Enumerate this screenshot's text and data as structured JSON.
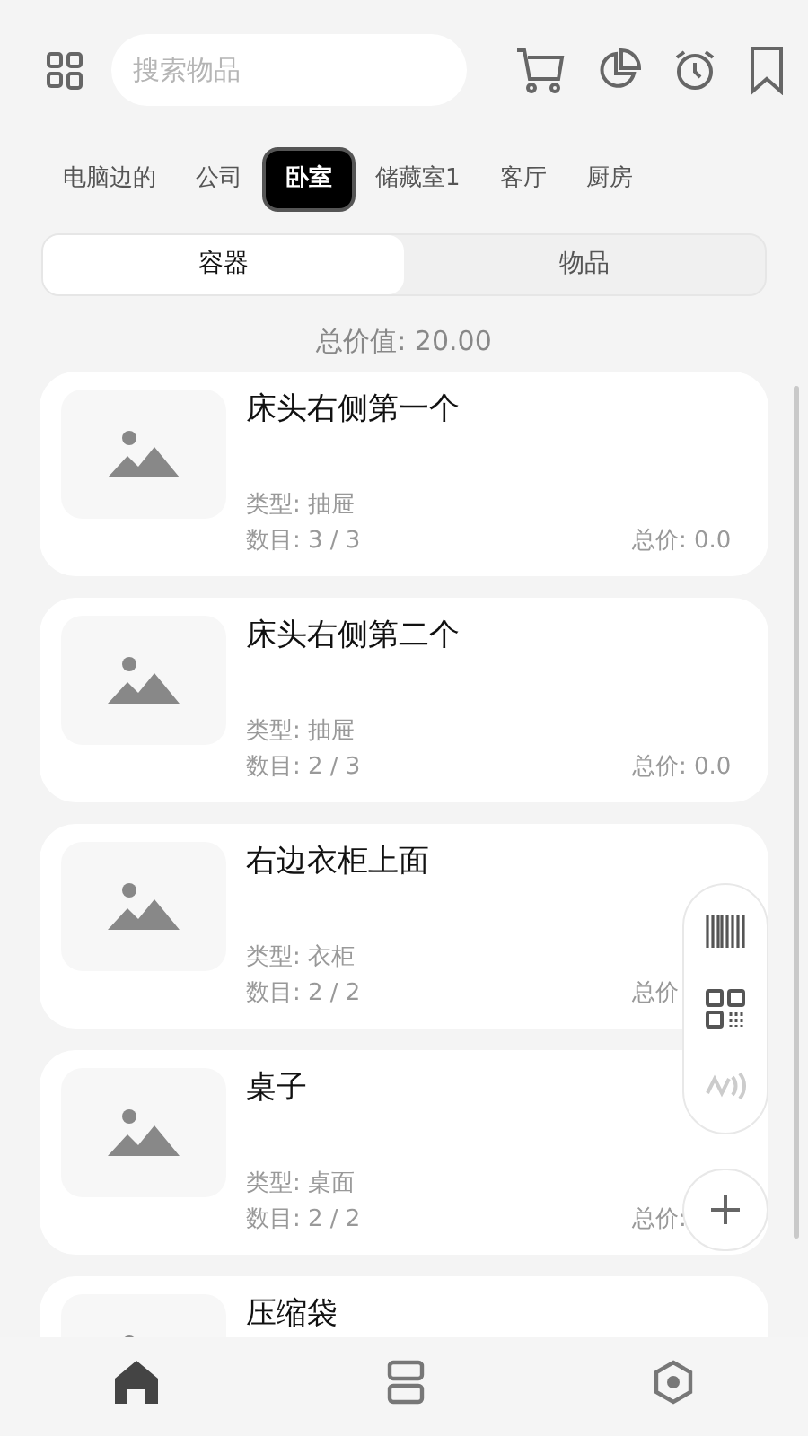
{
  "search": {
    "placeholder": "搜索物品"
  },
  "rooms": [
    {
      "label": "电脑边的",
      "selected": false
    },
    {
      "label": "公司",
      "selected": false
    },
    {
      "label": "卧室",
      "selected": true
    },
    {
      "label": "储藏室1",
      "selected": false
    },
    {
      "label": "客厅",
      "selected": false
    },
    {
      "label": "厨房",
      "selected": false
    }
  ],
  "segments": [
    {
      "label": "容器",
      "selected": true
    },
    {
      "label": "物品",
      "selected": false
    }
  ],
  "total_value": "总价值:  20.00",
  "containers": [
    {
      "title": "床头右侧第一个",
      "type": "类型: 抽屉",
      "count": "数目: 3 / 3",
      "price": "总价: 0.0"
    },
    {
      "title": "床头右侧第二个",
      "type": "类型: 抽屉",
      "count": "数目: 2 / 3",
      "price": "总价: 0.0"
    },
    {
      "title": "右边衣柜上面",
      "type": "类型: 衣柜",
      "count": "数目: 2 / 2",
      "price": "总价"
    },
    {
      "title": "桌子",
      "type": "类型: 桌面",
      "count": "数目: 2 / 2",
      "price": "总价:"
    },
    {
      "title": "压缩袋"
    }
  ],
  "bottom_nav": [
    {
      "kind": "home",
      "selected": true
    },
    {
      "kind": "list",
      "selected": false
    },
    {
      "kind": "settings",
      "selected": false
    }
  ]
}
